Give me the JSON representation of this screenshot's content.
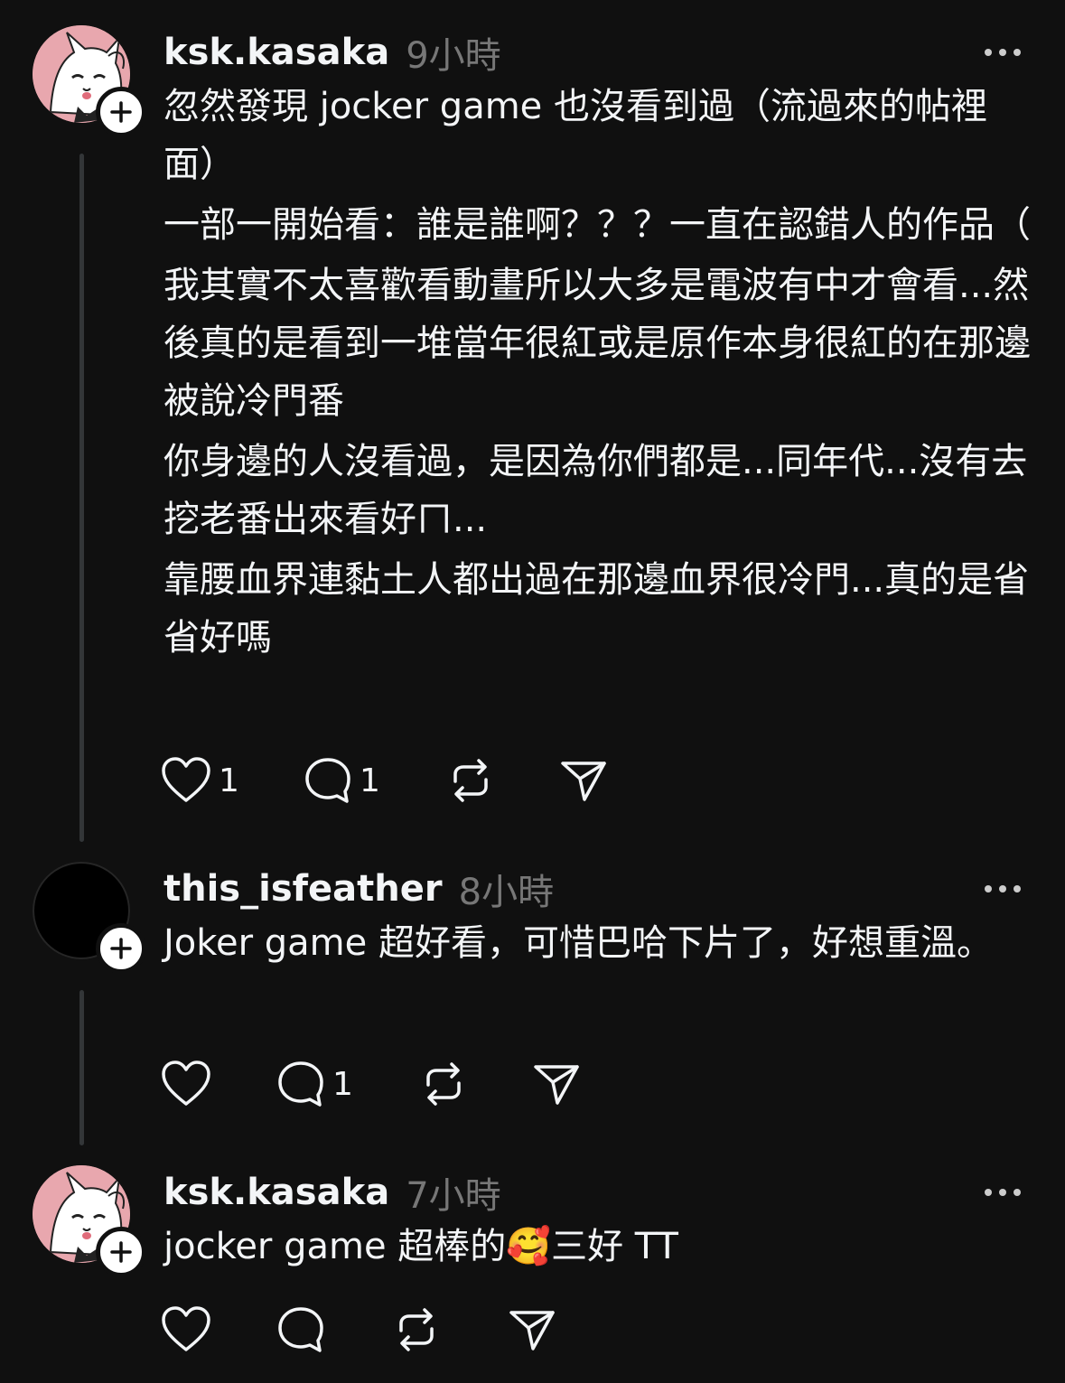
{
  "posts": [
    {
      "username": "ksk.kasaka",
      "time": "9小時",
      "paragraphs": [
        "忽然發現 jocker game 也沒看到過（流過來的帖裡面）",
        "一部一開始看：誰是誰啊？？？一直在認錯人的作品（",
        "我其實不太喜歡看動畫所以大多是電波有中才會看...然後真的是看到一堆當年很紅或是原作本身很紅的在那邊被說冷門番",
        "你身邊的人沒看過，是因為你們都是...同年代...沒有去挖老番出來看好ㄇ...",
        "靠腰血界連黏土人都出過在那邊血界很冷門...真的是省省好嗎"
      ],
      "likes": "1",
      "replies": "1",
      "reposts": "",
      "avatar_icon": "cartoon-cat-avatar"
    },
    {
      "username": "this_isfeather",
      "time": "8小時",
      "paragraphs": [
        "Joker game 超好看，可惜巴哈下片了，好想重溫。"
      ],
      "likes": "",
      "replies": "1",
      "reposts": "",
      "avatar_icon": "black-avatar"
    },
    {
      "username": "ksk.kasaka",
      "time": "7小時",
      "paragraphs": [
        "jocker game 超棒的🥰三好 TT"
      ],
      "likes": "",
      "replies": "",
      "reposts": "",
      "avatar_icon": "cartoon-cat-avatar"
    }
  ],
  "colors": {
    "background": "#101010",
    "text": "#f3f5f7",
    "muted": "#777777",
    "thread_line": "#333638",
    "avatar_pink": "#e8a7ae"
  },
  "icons": {
    "like": "heart-icon",
    "reply": "comment-bubble-icon",
    "repost": "repost-arrows-icon",
    "share": "paper-plane-icon",
    "more": "ellipsis-icon",
    "follow": "plus-icon"
  }
}
